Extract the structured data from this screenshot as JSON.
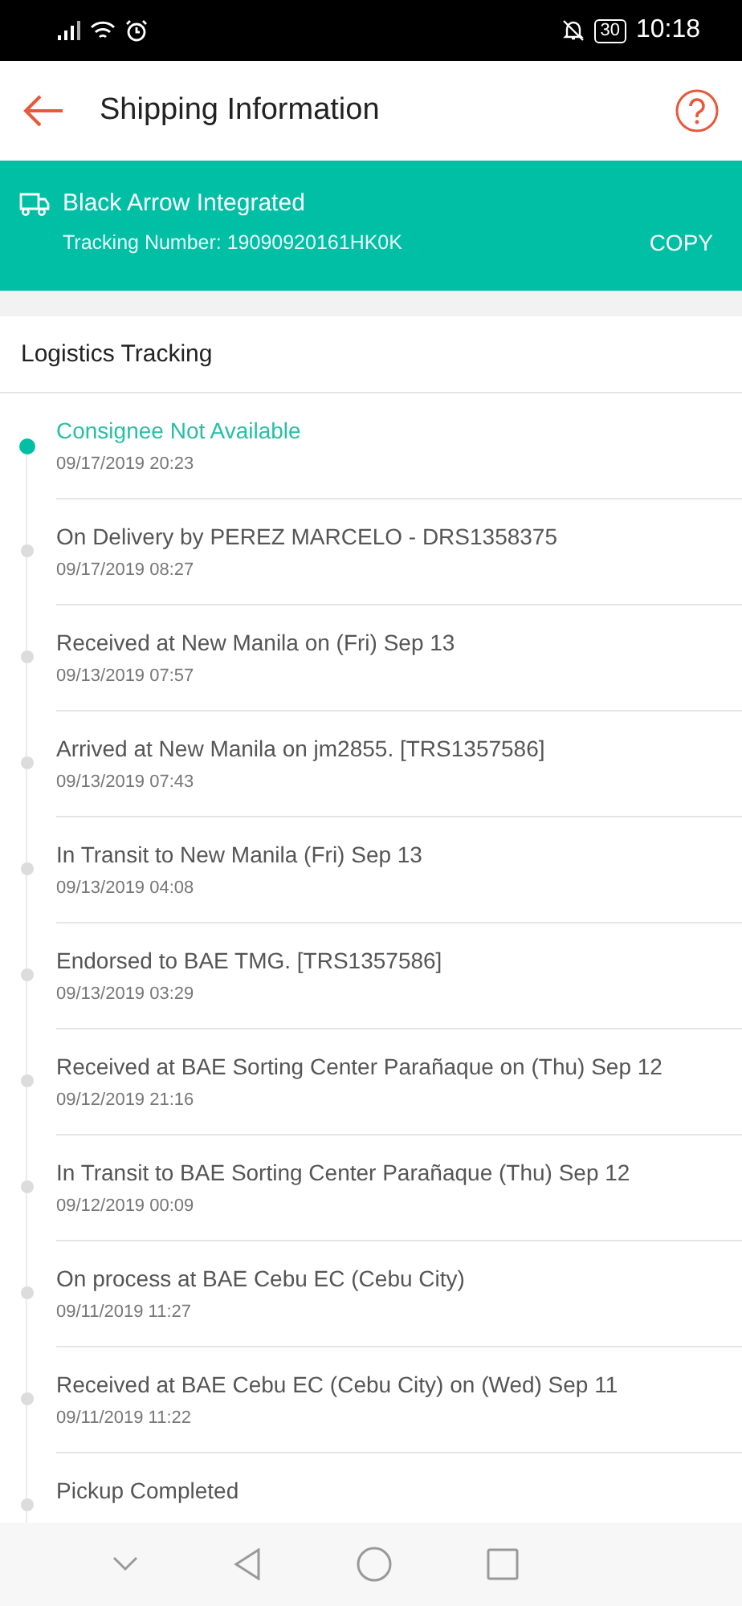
{
  "status_bar": {
    "battery": "30",
    "time": "10:18"
  },
  "header": {
    "title": "Shipping Information"
  },
  "carrier": {
    "name": "Black Arrow Integrated",
    "tracking": "Tracking Number: 19090920161HK0K",
    "copy": "COPY"
  },
  "tracking": {
    "title": "Logistics Tracking",
    "events": [
      {
        "title": "Consignee Not Available",
        "date": "09/17/2019 20:23",
        "current": true
      },
      {
        "title": "On Delivery by PEREZ MARCELO - DRS1358375",
        "date": "09/17/2019 08:27",
        "current": false
      },
      {
        "title": "Received at New Manila on (Fri) Sep 13",
        "date": "09/13/2019 07:57",
        "current": false
      },
      {
        "title": "Arrived at New Manila on jm2855. [TRS1357586]",
        "date": "09/13/2019 07:43",
        "current": false
      },
      {
        "title": "In Transit to New Manila (Fri) Sep 13",
        "date": "09/13/2019 04:08",
        "current": false
      },
      {
        "title": "Endorsed to BAE TMG. [TRS1357586]",
        "date": "09/13/2019 03:29",
        "current": false
      },
      {
        "title": "Received at BAE Sorting Center Parañaque on (Thu) Sep 12",
        "date": "09/12/2019 21:16",
        "current": false
      },
      {
        "title": "In Transit to BAE Sorting Center Parañaque (Thu) Sep 12",
        "date": "09/12/2019 00:09",
        "current": false
      },
      {
        "title": "On process at BAE Cebu EC (Cebu City)",
        "date": "09/11/2019 11:27",
        "current": false
      },
      {
        "title": "Received at BAE Cebu EC (Cebu City) on (Wed) Sep 11",
        "date": "09/11/2019 11:22",
        "current": false
      },
      {
        "title": "Pickup Completed",
        "current": false
      }
    ]
  }
}
